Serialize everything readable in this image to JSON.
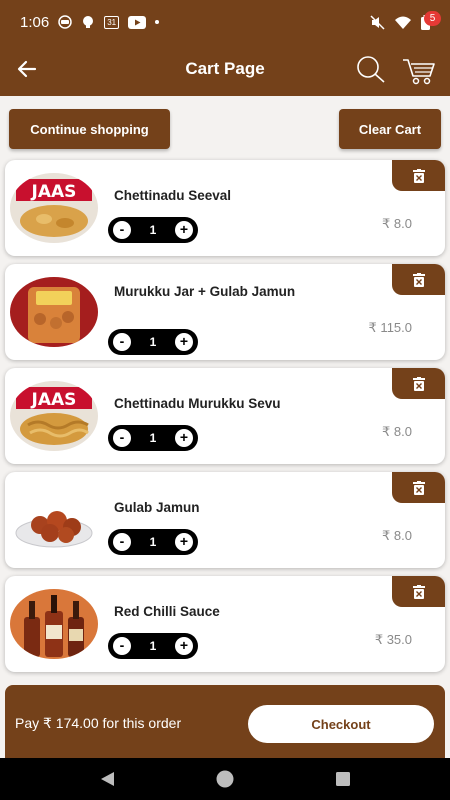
{
  "status": {
    "time": "1:06",
    "calendar_day": "31"
  },
  "header": {
    "title": "Cart Page",
    "cart_count": "5"
  },
  "actions": {
    "continue_label": "Continue shopping",
    "clear_label": "Clear Cart"
  },
  "currency": "₹",
  "items": [
    {
      "name": "Chettinadu Seeval",
      "qty": "1",
      "price": "₹ 8.0",
      "image_icon": "chips-pack-icon"
    },
    {
      "name": "Murukku Jar + Gulab Jamun",
      "qty": "1",
      "price": "₹ 115.0",
      "image_icon": "murukku-jar-icon"
    },
    {
      "name": "Chettinadu Murukku Sevu",
      "qty": "1",
      "price": "₹ 8.0",
      "image_icon": "chips-pack-icon"
    },
    {
      "name": "Gulab Jamun",
      "qty": "1",
      "price": "₹ 8.0",
      "image_icon": "sweet-bowl-icon"
    },
    {
      "name": "Red Chilli Sauce",
      "qty": "1",
      "price": "₹ 35.0",
      "image_icon": "sauce-bottles-icon"
    }
  ],
  "stepper": {
    "minus": "-",
    "plus": "+"
  },
  "footer": {
    "pay_text": "Pay ₹ 174.00 for this order",
    "checkout_label": "Checkout"
  },
  "colors": {
    "brand": "#74411a",
    "badge": "#e53935"
  }
}
